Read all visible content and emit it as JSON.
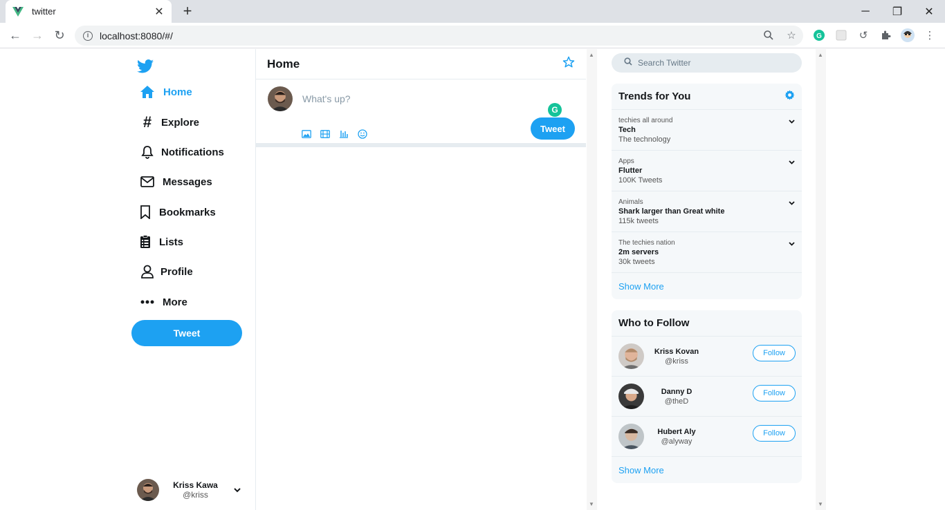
{
  "browser": {
    "tab_title": "twitter",
    "url": "localhost:8080/#/"
  },
  "brand": {
    "accent": "#1da1f2"
  },
  "sidebar": {
    "items": [
      {
        "label": "Home",
        "icon": "home-icon",
        "active": true
      },
      {
        "label": "Explore",
        "icon": "hashtag-icon"
      },
      {
        "label": "Notifications",
        "icon": "bell-icon"
      },
      {
        "label": "Messages",
        "icon": "envelope-icon"
      },
      {
        "label": "Bookmarks",
        "icon": "bookmark-icon"
      },
      {
        "label": "Lists",
        "icon": "list-icon"
      },
      {
        "label": "Profile",
        "icon": "user-icon"
      },
      {
        "label": "More",
        "icon": "more-icon"
      }
    ],
    "tweet_label": "Tweet",
    "account": {
      "name": "Kriss Kawa",
      "handle": "@kriss"
    }
  },
  "main": {
    "title": "Home",
    "compose": {
      "placeholder": "What's up?",
      "tweet_label": "Tweet"
    }
  },
  "right": {
    "search_placeholder": "Search Twitter",
    "trends": {
      "title": "Trends for You",
      "items": [
        {
          "category": "techies all around",
          "title": "Tech",
          "count": "The technology"
        },
        {
          "category": "Apps",
          "title": "Flutter",
          "count": "100K Tweets"
        },
        {
          "category": "Animals",
          "title": "Shark larger than Great white",
          "count": "115k tweets"
        },
        {
          "category": "The techies nation",
          "title": "2m servers",
          "count": "30k tweets"
        }
      ],
      "show_more": "Show More"
    },
    "who_to_follow": {
      "title": "Who to Follow",
      "users": [
        {
          "name": "Kriss Kovan",
          "handle": "@kriss",
          "button": "Follow"
        },
        {
          "name": "Danny D",
          "handle": "@theD",
          "button": "Follow"
        },
        {
          "name": "Hubert Aly",
          "handle": "@alyway",
          "button": "Follow"
        }
      ],
      "show_more": "Show More"
    }
  }
}
